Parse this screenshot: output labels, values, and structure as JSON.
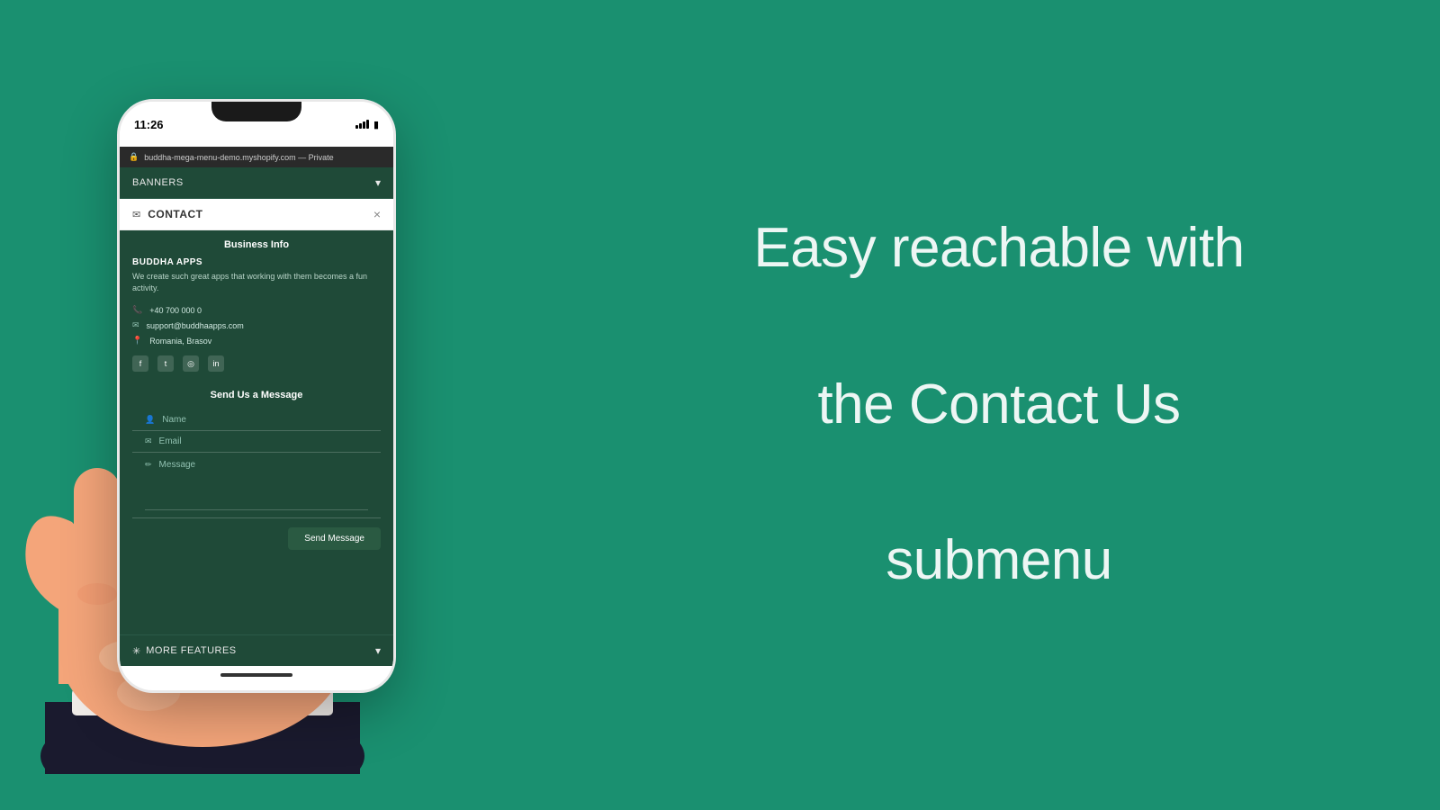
{
  "background_color": "#1a9070",
  "phone": {
    "time": "11:26",
    "url": "buddha-mega-menu-demo.myshopify.com — Private",
    "banners": {
      "label": "BANNERS",
      "chevron": "▾"
    },
    "contact_header": {
      "label": "CONTACT",
      "close": "×"
    },
    "business_info": {
      "section_title": "Business Info",
      "business_name": "BUDDHA APPS",
      "description": "We create such great apps that working with them becomes a fun activity.",
      "phone": "+40 700 000 0",
      "email": "support@buddhaapps.com",
      "location": "Romania, Brasov",
      "social": [
        "f",
        "t",
        "◎",
        "in"
      ]
    },
    "send_message": {
      "section_title": "Send Us a Message",
      "name_placeholder": "Name",
      "email_placeholder": "Email",
      "message_placeholder": "Message",
      "send_btn": "Send Message"
    },
    "more_features": {
      "label": "MORE FEATURES",
      "chevron": "▾"
    }
  },
  "headline": {
    "line1": "Easy reachable with",
    "line2": "the Contact Us",
    "line3": "submenu"
  }
}
